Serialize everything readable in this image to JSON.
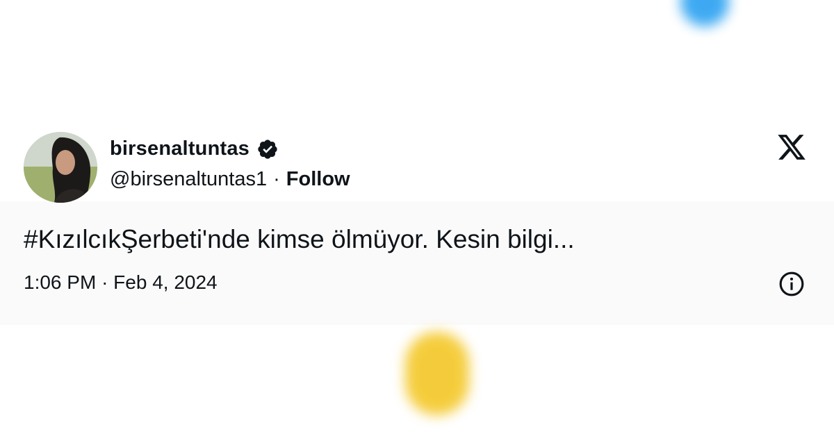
{
  "tweet": {
    "display_name": "birsenaltuntas",
    "handle": "@birsenaltuntas1",
    "separator": "·",
    "follow_label": "Follow",
    "text": "#KızılcıkŞerbeti'nde kimse ölmüyor. Kesin bilgi...",
    "time": "1:06 PM",
    "date": "Feb 4, 2024",
    "verified_icon": "verified-badge-icon",
    "brand_icon": "x-logo-icon",
    "info_icon": "info-icon"
  },
  "colors": {
    "text": "#0f1419",
    "verified": "#0f1419",
    "background": "#ffffff"
  }
}
